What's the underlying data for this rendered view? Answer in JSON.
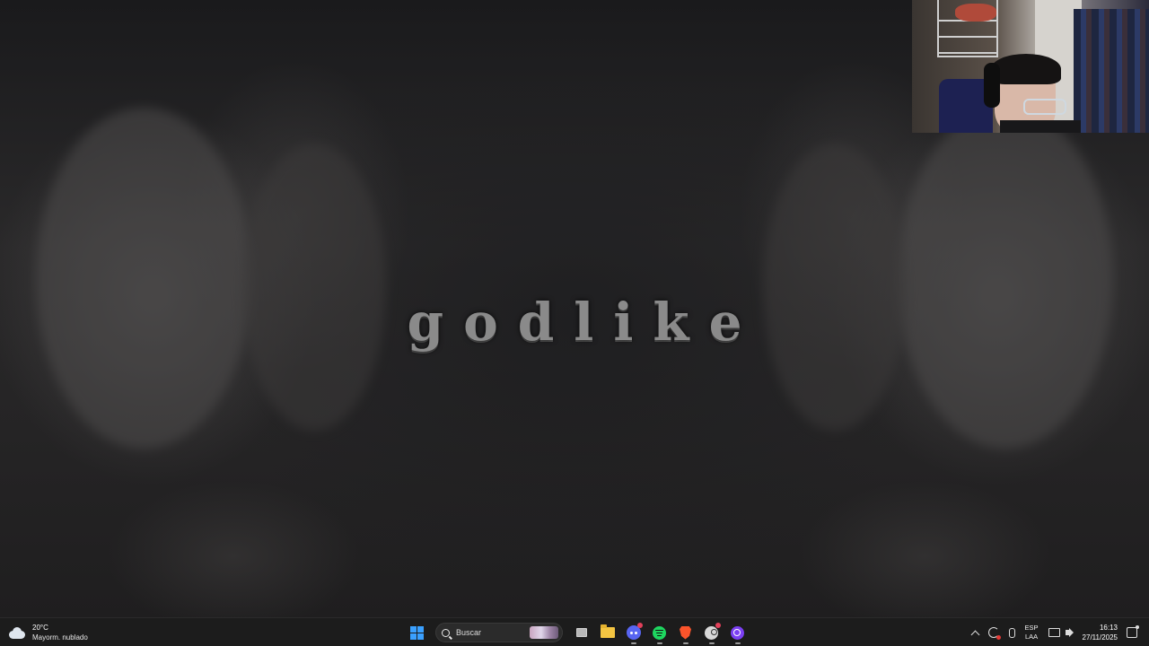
{
  "wallpaper": {
    "title": "godlike"
  },
  "webcam": {
    "icon": "webcam-overlay"
  },
  "taskbar": {
    "weather": {
      "temperature": "20°C",
      "description": "Mayorm. nublado",
      "icon": "partly-cloudy-icon"
    },
    "search": {
      "placeholder": "Buscar"
    },
    "pinned_apps": [
      {
        "name": "start",
        "icon": "windows-start-icon"
      },
      {
        "name": "task-view",
        "icon": "task-view-icon"
      },
      {
        "name": "file-explorer",
        "icon": "folder-icon"
      },
      {
        "name": "discord",
        "icon": "discord-icon",
        "badge": true
      },
      {
        "name": "spotify",
        "icon": "spotify-icon"
      },
      {
        "name": "brave",
        "icon": "brave-icon"
      },
      {
        "name": "steam",
        "icon": "steam-icon",
        "badge": true
      },
      {
        "name": "circle-app",
        "icon": "circle-app-icon"
      }
    ],
    "tray": {
      "language_top": "ESP",
      "language_bottom": "LAA",
      "time": "16:13",
      "date": "27/11/2025"
    }
  },
  "colors": {
    "taskbar_bg": "#1c1c1c",
    "accent_start": "#3aa0ff",
    "title_color": "#8a8a8a"
  }
}
